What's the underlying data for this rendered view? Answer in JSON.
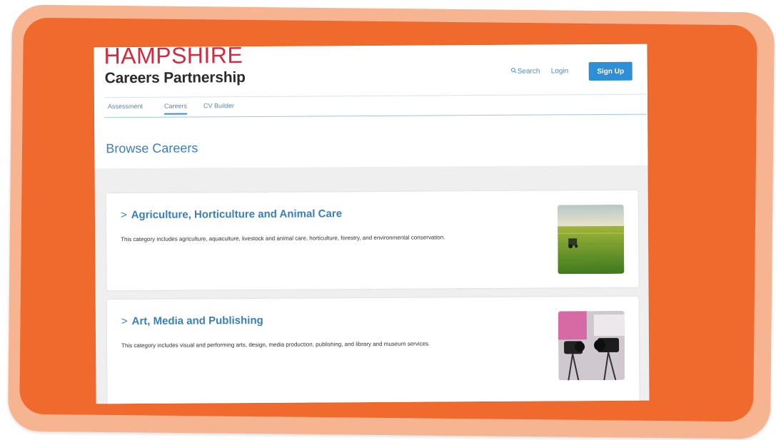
{
  "site": {
    "logo_line1": "HAMPSHIRE",
    "logo_line2": "Careers Partnership"
  },
  "header": {
    "search_label": "Search",
    "login_label": "Login",
    "signup_label": "Sign Up"
  },
  "tabs": [
    {
      "label": "Assessment",
      "active": false
    },
    {
      "label": "Careers",
      "active": true
    },
    {
      "label": "CV Builder",
      "active": false
    }
  ],
  "page": {
    "title": "Browse Careers"
  },
  "categories": [
    {
      "title": "Agriculture, Horticulture and Animal Care",
      "description": "This category includes agriculture, aquaculture, livestock and animal care, horticulture, forestry, and environmental conservation.",
      "image": "tractor-field-image"
    },
    {
      "title": "Art, Media and Publishing",
      "description": "This category includes visual and performing arts, design, media production, publishing, and library and museum services.",
      "image": "camera-media-image"
    }
  ],
  "colors": {
    "frame_outer": "#f6b491",
    "frame_inner": "#ef6a2c",
    "logo_red": "#d42a3f",
    "link_blue": "#3f8fd0",
    "button_blue": "#2f8fd6"
  }
}
